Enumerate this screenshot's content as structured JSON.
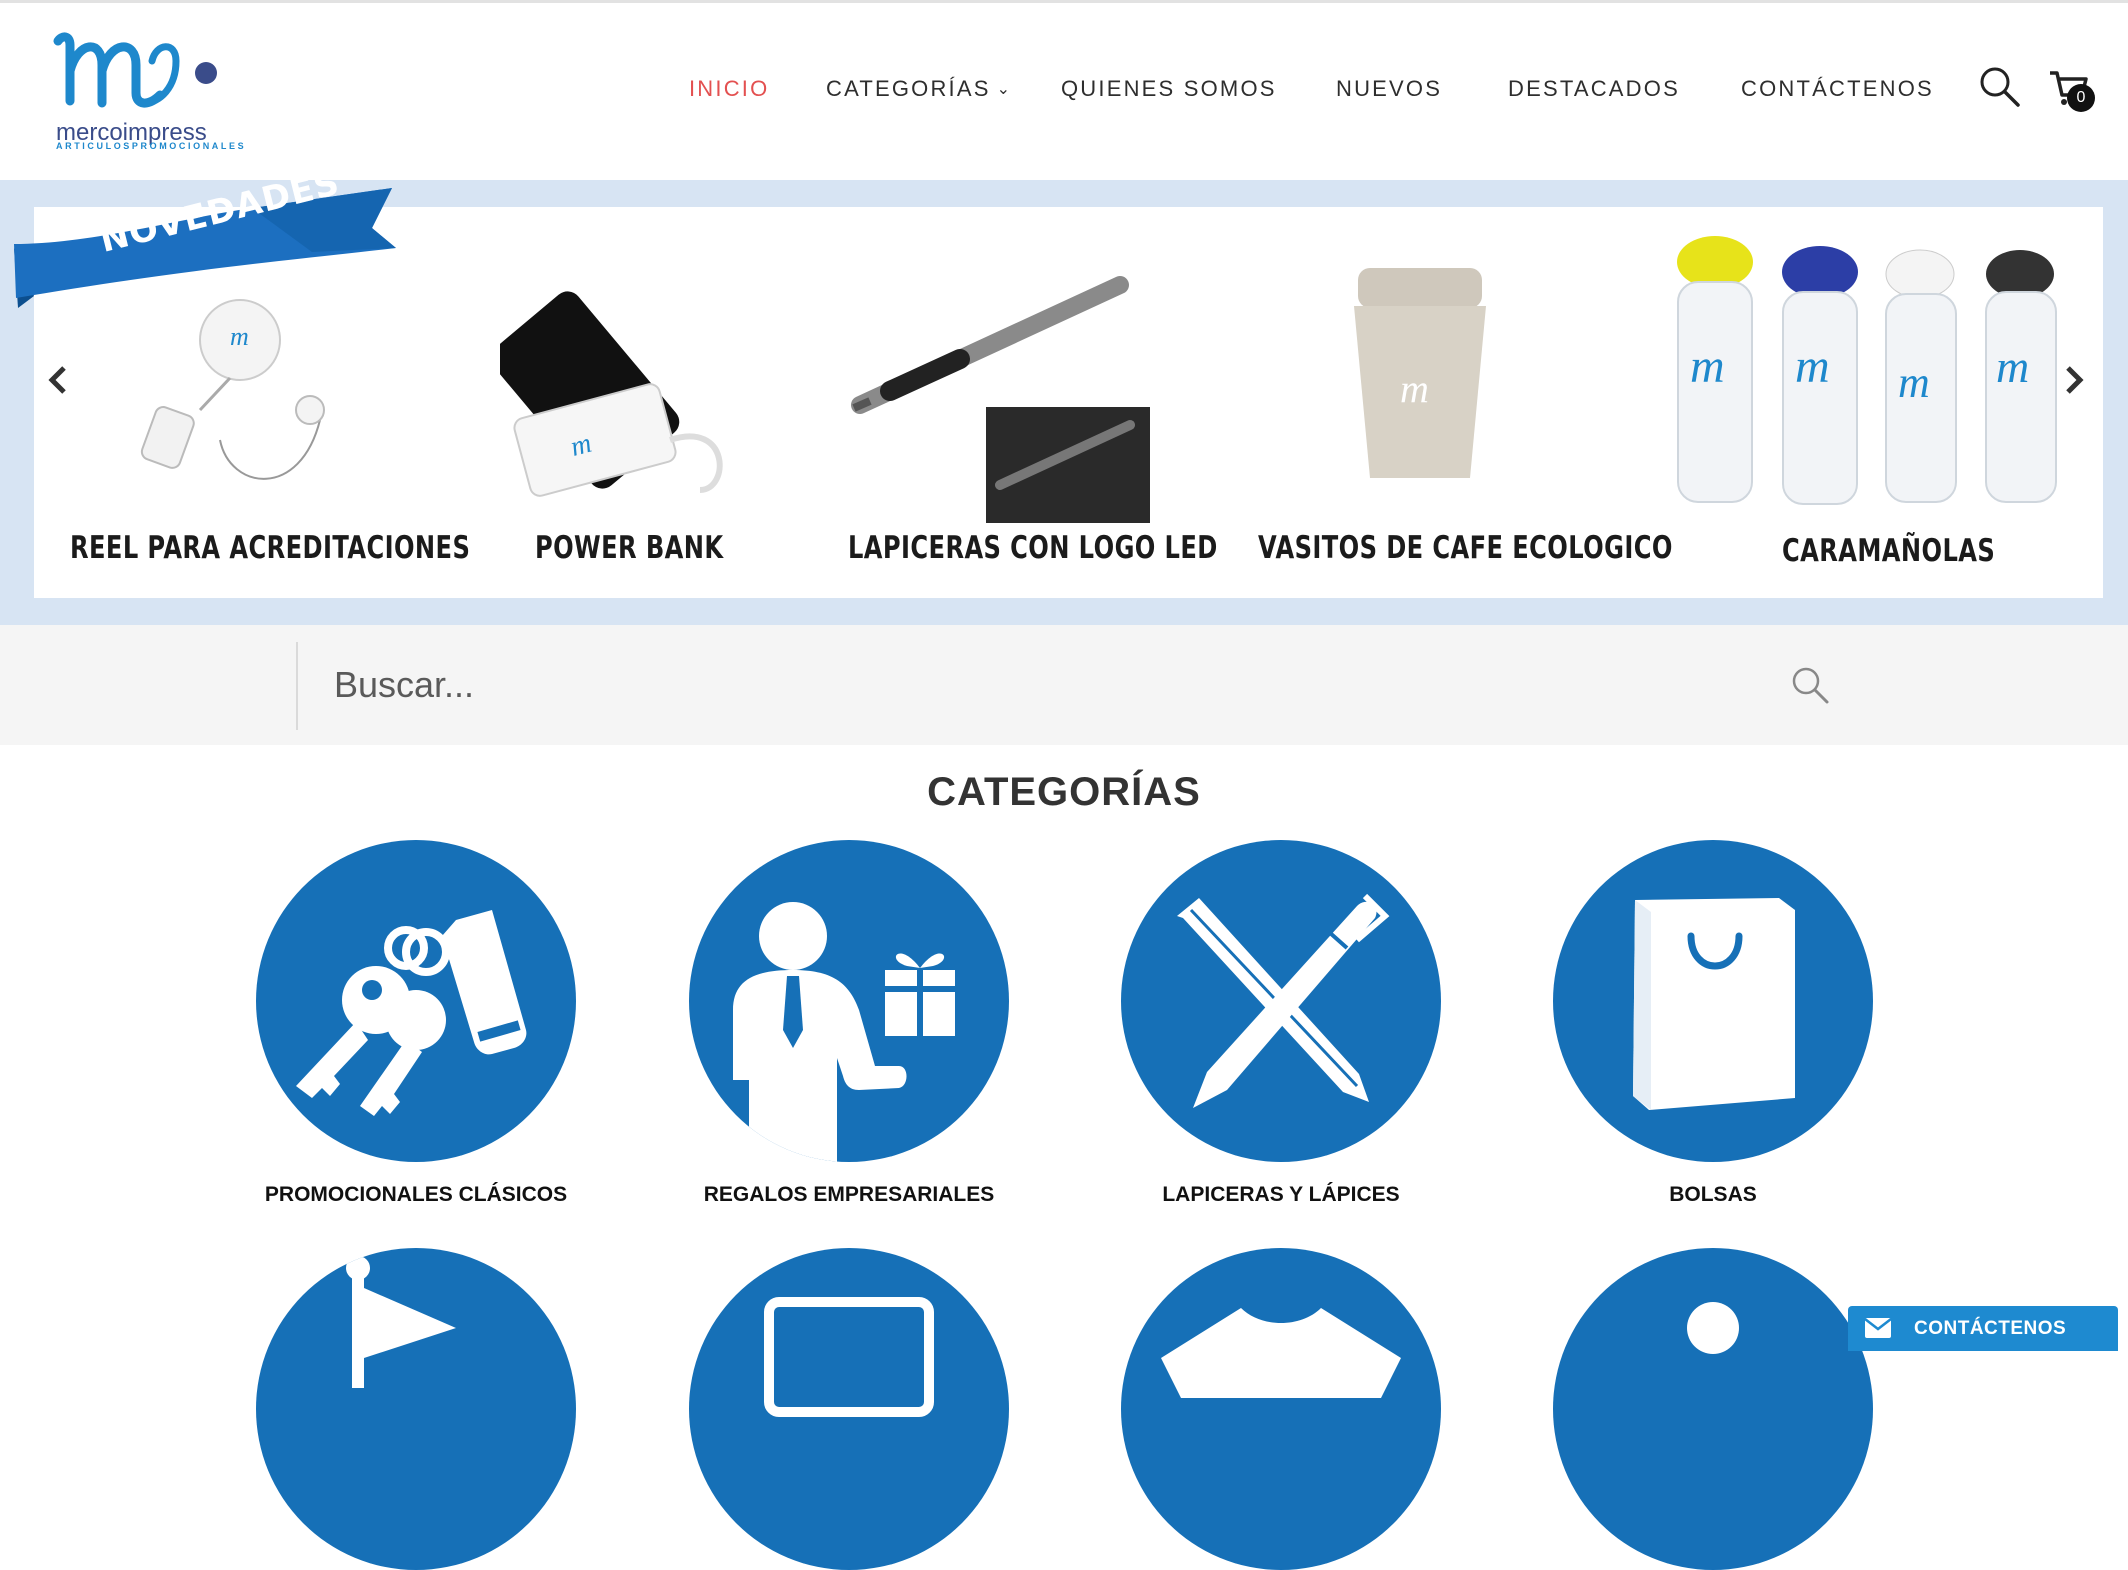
{
  "brand": {
    "name": "mercoimpress",
    "tagline": "ARTICULOSPROMOCIONALES",
    "primary_color": "#1670b7",
    "accent_color": "#e35050"
  },
  "nav": {
    "items": [
      {
        "label": "INICIO",
        "active": true
      },
      {
        "label": "CATEGORÍAS",
        "has_dropdown": true
      },
      {
        "label": "QUIENES SOMOS"
      },
      {
        "label": "NUEVOS"
      },
      {
        "label": "DESTACADOS"
      },
      {
        "label": "CONTÁCTENOS"
      }
    ],
    "cart_count": "0",
    "icons": [
      "search-icon",
      "cart-icon"
    ]
  },
  "slider": {
    "ribbon": "NOVEDADES",
    "slides": [
      {
        "label": "REEL PARA ACREDITACIONES"
      },
      {
        "label": "POWER BANK"
      },
      {
        "label": "LAPICERAS CON LOGO LED"
      },
      {
        "label": "VASITOS DE CAFE ECOLOGICO"
      },
      {
        "label": "CARAMAÑOLAS"
      }
    ]
  },
  "search": {
    "placeholder": "Buscar..."
  },
  "categories": {
    "title": "CATEGORÍAS",
    "items": [
      {
        "label": "PROMOCIONALES CLÁSICOS",
        "icon": "keys-icon"
      },
      {
        "label": "REGALOS EMPRESARIALES",
        "icon": "businessman-gift-icon"
      },
      {
        "label": "LAPICERAS Y LÁPICES",
        "icon": "pen-pencil-icon"
      },
      {
        "label": "BOLSAS",
        "icon": "bag-icon"
      }
    ]
  },
  "floating_contact": {
    "label": "CONTÁCTENOS",
    "icon": "mail-icon"
  }
}
